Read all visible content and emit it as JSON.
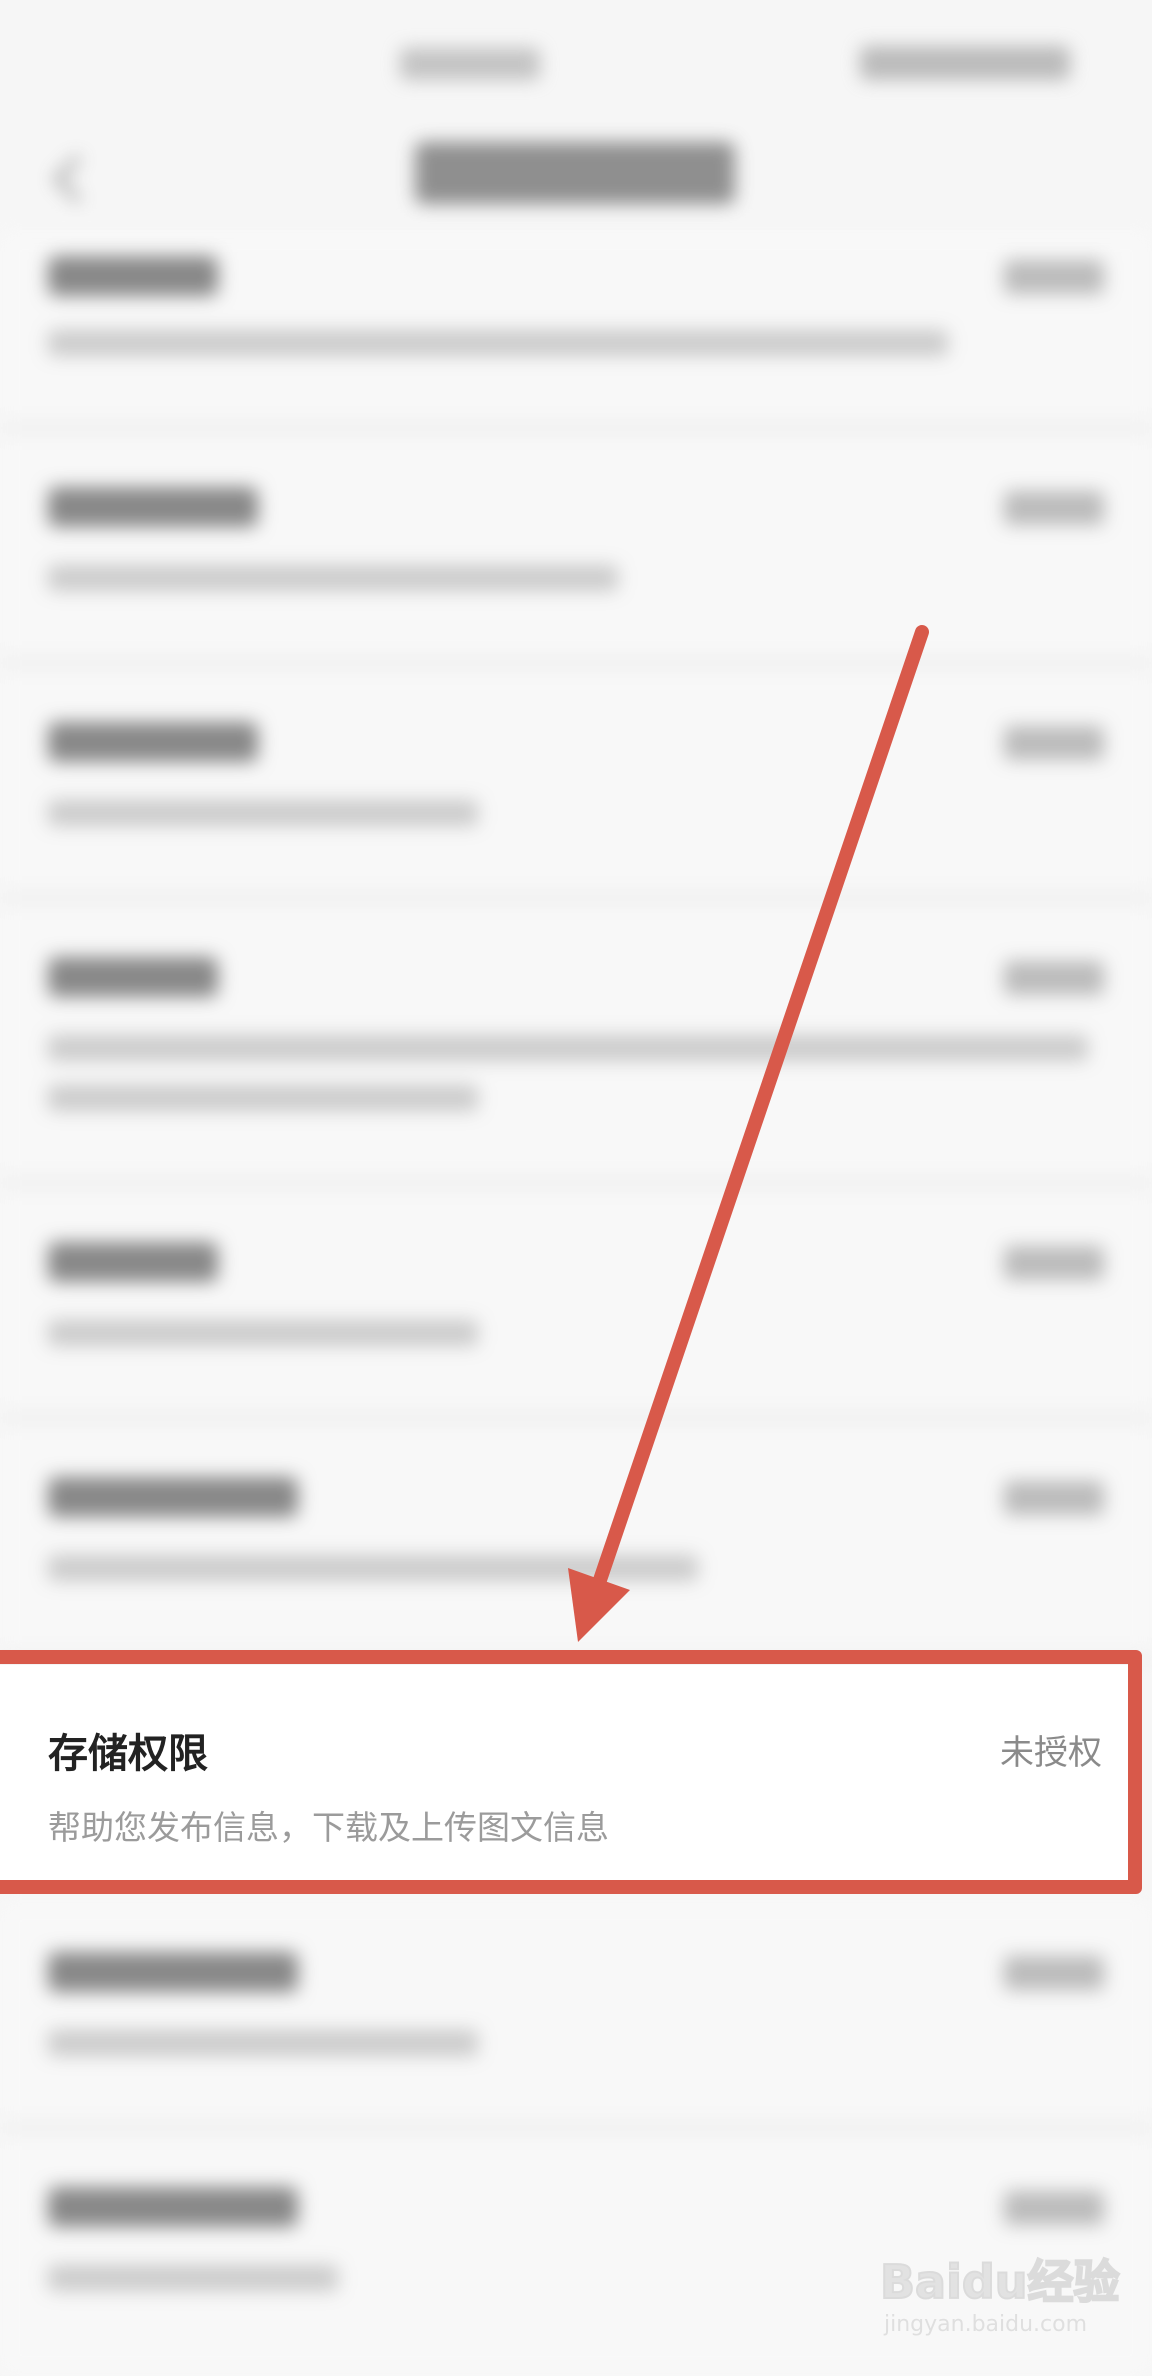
{
  "permission_list": {
    "storage": {
      "title": "存储权限",
      "status": "未授权",
      "description": "帮助您发布信息，下载及上传图文信息"
    }
  },
  "watermark": {
    "logo_text": "Baidu经验",
    "url": "jingyan.baidu.com"
  },
  "colors": {
    "highlight": "#d8594a",
    "background": "#f6f6f6"
  },
  "icons": {
    "back": "back-chevron-icon",
    "arrow": "red-arrow-annotation"
  }
}
